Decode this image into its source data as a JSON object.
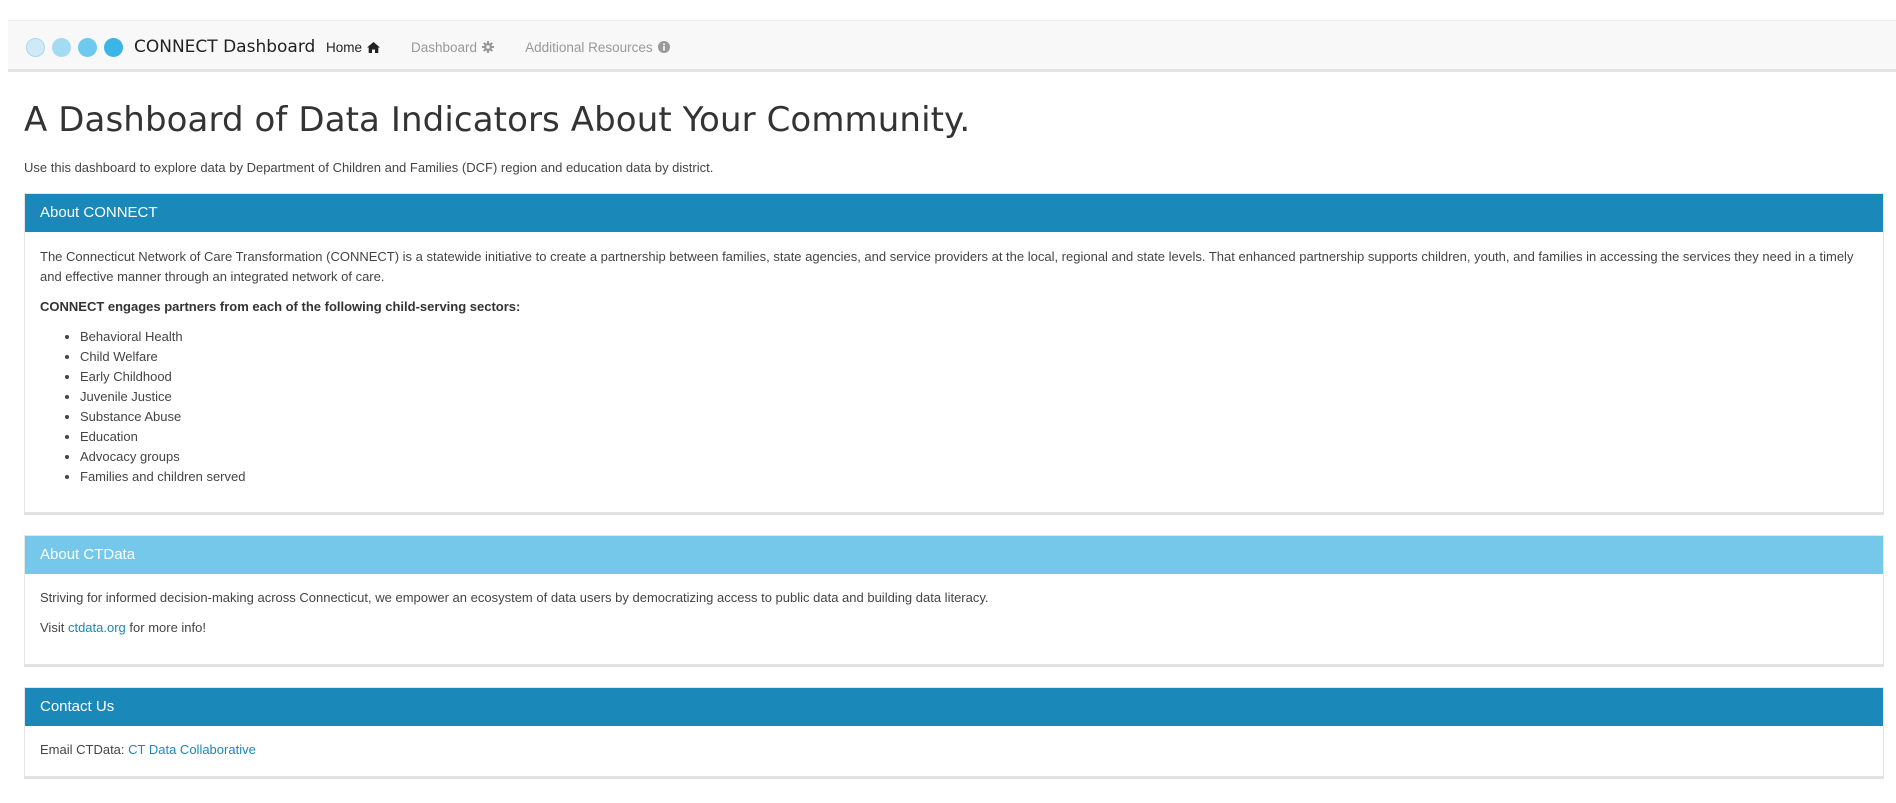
{
  "brand": {
    "title": "CONNECT Dashboard",
    "dot_colors": [
      "#cfeaf6",
      "#a3dcf2",
      "#6ec9ee",
      "#3bb4e7"
    ]
  },
  "nav": [
    {
      "label": "Home",
      "icon": "home-icon"
    },
    {
      "label": "Dashboard",
      "icon": "gear-icon"
    },
    {
      "label": "Additional Resources",
      "icon": "info-circle-icon"
    }
  ],
  "page": {
    "title": "A Dashboard of Data Indicators About Your Community.",
    "subtitle": "Use this dashboard to explore data by Department of Children and Families (DCF) region and education data by district."
  },
  "about_connect": {
    "header": "About CONNECT",
    "header_color": "#1a88b9",
    "intro": "The Connecticut Network of Care Transformation (CONNECT) is a statewide initiative to create a partnership between families, state agencies, and service providers at the local, regional and state levels. That enhanced partnership supports children, youth, and families in accessing the services they need in a timely and effective manner through an integrated network of care.",
    "sectors_heading": "CONNECT engages partners from each of the following child-serving sectors:",
    "sectors": [
      "Behavioral Health",
      "Child Welfare",
      "Early Childhood",
      "Juvenile Justice",
      "Substance Abuse",
      "Education",
      "Advocacy groups",
      "Families and children served"
    ]
  },
  "about_ctdata": {
    "header": "About CTData",
    "header_color": "#76c8ea",
    "text": "Striving for informed decision-making across Connecticut, we empower an ecosystem of data users by democratizing access to public data and building data literacy.",
    "visit_prefix": "Visit",
    "visit_link": "ctdata.org",
    "visit_suffix": "for more info!"
  },
  "contact": {
    "header": "Contact Us",
    "header_color": "#1a88b9",
    "email_label": "Email CTData:",
    "email_link": "CT Data Collaborative"
  }
}
